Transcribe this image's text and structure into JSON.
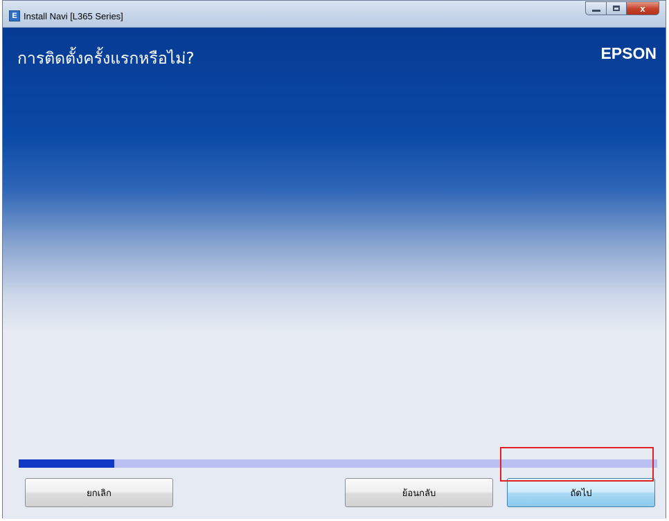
{
  "window": {
    "title": "Install Navi [L365 Series]",
    "app_icon": "E",
    "close_glyph": "x"
  },
  "page": {
    "heading": "การติดตั้งครั้งแรกหรือไม่?",
    "brand": "EPSON"
  },
  "progress": {
    "fraction": 0.15
  },
  "buttons": {
    "cancel": "ยกเลิก",
    "back": "ย้อนกลับ",
    "next": "ถัดไป"
  },
  "colors": {
    "accent_blue": "#063a93",
    "progress_fill": "#1238c6",
    "highlight": "#e02020"
  }
}
